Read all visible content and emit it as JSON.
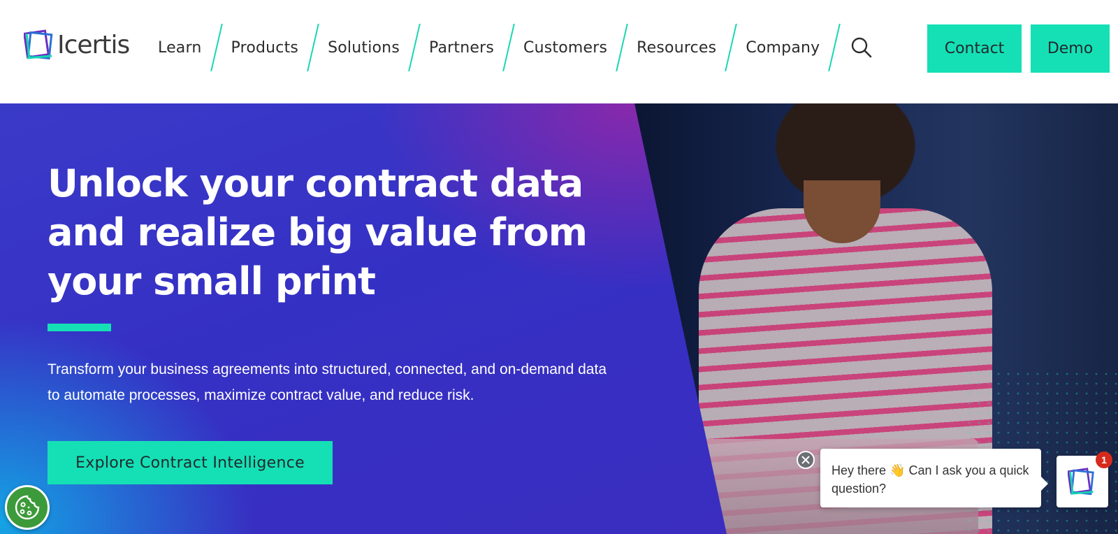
{
  "brand": {
    "name": "Icertis",
    "logo_colors": [
      "#15d6b0",
      "#6b2fc0",
      "#2a6fd6"
    ]
  },
  "nav": {
    "items": [
      {
        "label": "Learn"
      },
      {
        "label": "Products"
      },
      {
        "label": "Solutions"
      },
      {
        "label": "Partners"
      },
      {
        "label": "Customers"
      },
      {
        "label": "Resources"
      },
      {
        "label": "Company"
      }
    ],
    "search_icon": "search-icon",
    "contact_label": "Contact",
    "demo_label": "Demo"
  },
  "hero": {
    "title": "Unlock your contract data and realize big value from your small print",
    "subtitle": "Transform your business agreements into structured, connected, and on-demand data to automate processes, maximize contract value, and reduce risk.",
    "cta_label": "Explore Contract Intelligence"
  },
  "chat": {
    "message": "Hey there 👋 Can I ask you a quick question?",
    "badge_count": "1",
    "close_icon": "close-icon"
  },
  "cookie": {
    "icon": "cookie-icon"
  },
  "colors": {
    "accent": "#15e0b5",
    "hero_blue": "#3530c4",
    "hero_purple": "#8c28aa",
    "hero_cyan": "#12aae6",
    "badge_red": "#d62a1c",
    "cookie_green": "#3d9a3a"
  }
}
